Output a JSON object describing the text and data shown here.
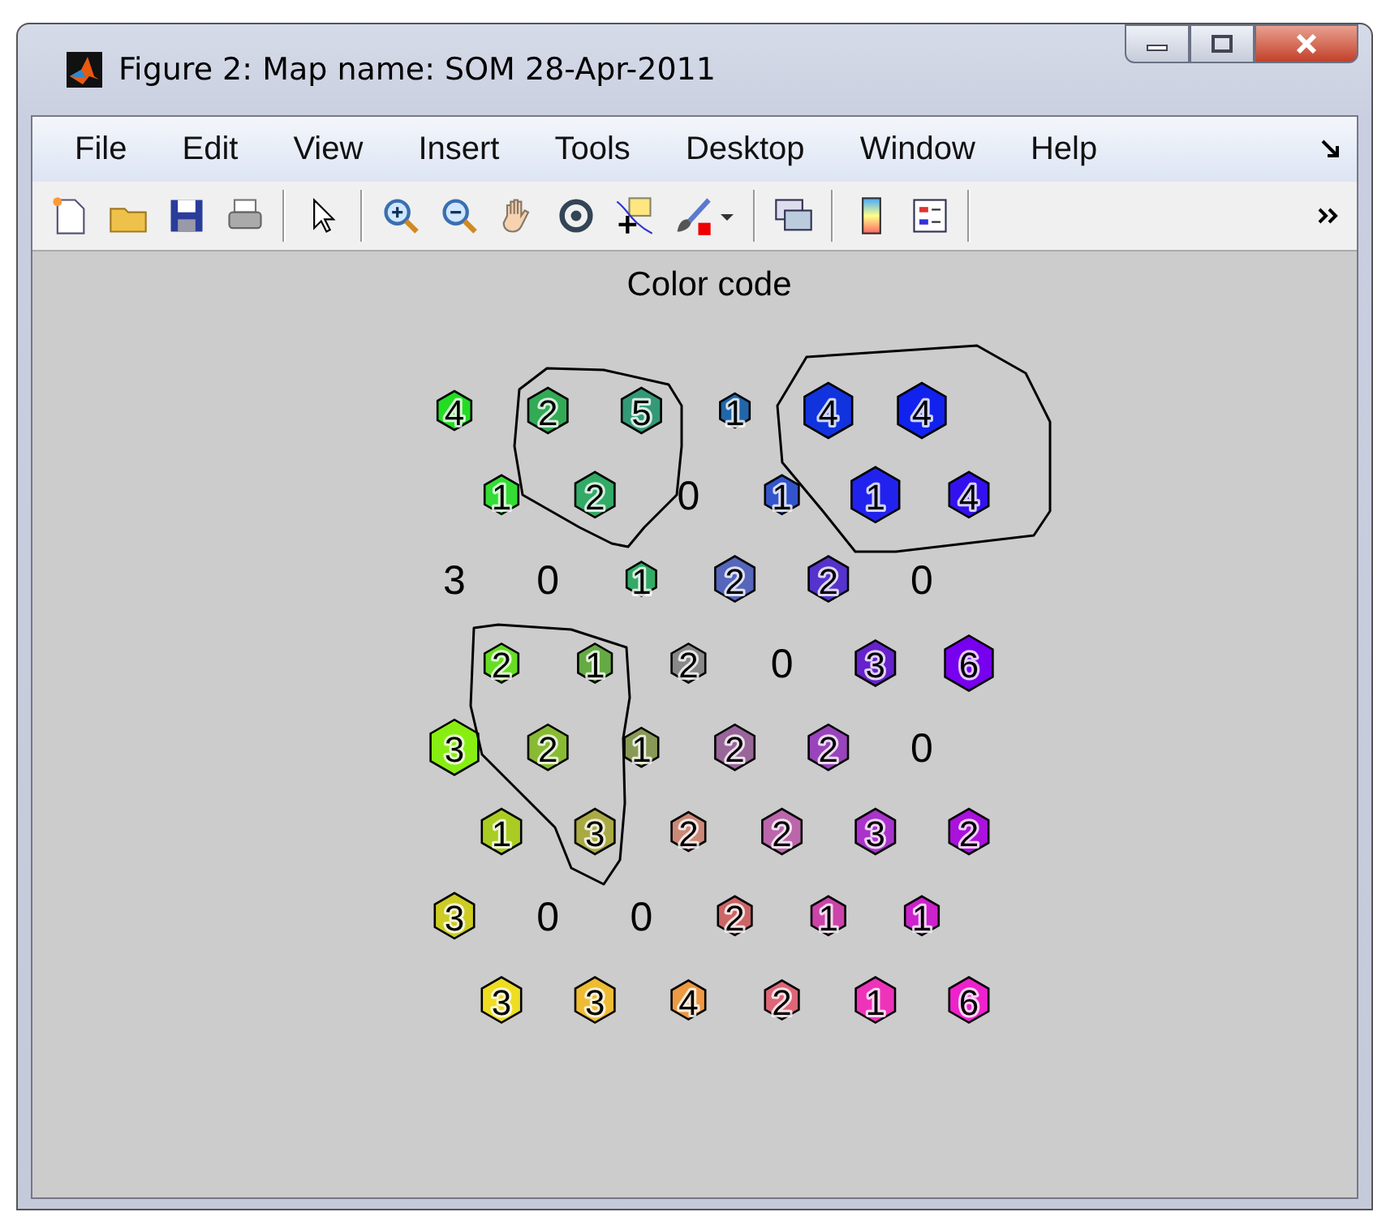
{
  "window": {
    "title": "Figure 2: Map name: SOM 28-Apr-2011"
  },
  "menu": [
    "File",
    "Edit",
    "View",
    "Insert",
    "Tools",
    "Desktop",
    "Window",
    "Help"
  ],
  "plot": {
    "title": "Color code",
    "cells": [
      [
        {
          "label": "4",
          "color": "#22dd22",
          "kind": "small"
        },
        {
          "label": "2",
          "color": "#33aa55",
          "kind": "medium"
        },
        {
          "label": "5",
          "color": "#339977",
          "kind": "medium"
        },
        {
          "label": "1",
          "color": "#2266aa",
          "kind": "tiny"
        },
        {
          "label": "4",
          "color": "#1133dd",
          "kind": "large"
        },
        {
          "label": "4",
          "color": "#1122ee",
          "kind": "large"
        }
      ],
      [
        {
          "label": "1",
          "color": "#33dd33",
          "kind": "small"
        },
        {
          "label": "2",
          "color": "#33aa66",
          "kind": "medium"
        },
        {
          "label": "0"
        },
        {
          "label": "1",
          "color": "#3355cc",
          "kind": "small"
        },
        {
          "label": "1",
          "color": "#2222ee",
          "kind": "large"
        },
        {
          "label": "4",
          "color": "#3311ee",
          "kind": "medium"
        }
      ],
      [
        {
          "label": "3"
        },
        {
          "label": "0"
        },
        {
          "label": "1",
          "color": "#33aa66",
          "kind": "tiny"
        },
        {
          "label": "2",
          "color": "#5566bb",
          "kind": "medium"
        },
        {
          "label": "2",
          "color": "#5533cc",
          "kind": "medium"
        },
        {
          "label": "0"
        }
      ],
      [
        {
          "label": "2",
          "color": "#66dd22",
          "kind": "small"
        },
        {
          "label": "1",
          "color": "#66aa44",
          "kind": "small"
        },
        {
          "label": "2",
          "color": "#888888",
          "kind": "small"
        },
        {
          "label": "0"
        },
        {
          "label": "3",
          "color": "#6622cc",
          "kind": "medium"
        },
        {
          "label": "6",
          "color": "#7700ee",
          "kind": "large"
        }
      ],
      [
        {
          "label": "3",
          "color": "#88ee11",
          "kind": "large"
        },
        {
          "label": "2",
          "color": "#88bb33",
          "kind": "medium"
        },
        {
          "label": "1",
          "color": "#889955",
          "kind": "small"
        },
        {
          "label": "2",
          "color": "#996699",
          "kind": "medium"
        },
        {
          "label": "2",
          "color": "#9944bb",
          "kind": "medium"
        },
        {
          "label": "0"
        }
      ],
      [
        {
          "label": "1",
          "color": "#aacc22",
          "kind": "medium"
        },
        {
          "label": "3",
          "color": "#aaaa44",
          "kind": "medium"
        },
        {
          "label": "2",
          "color": "#cc8877",
          "kind": "small"
        },
        {
          "label": "2",
          "color": "#bb66aa",
          "kind": "medium"
        },
        {
          "label": "3",
          "color": "#aa33cc",
          "kind": "medium"
        },
        {
          "label": "2",
          "color": "#aa11dd",
          "kind": "medium"
        }
      ],
      [
        {
          "label": "3",
          "color": "#cccc22",
          "kind": "medium"
        },
        {
          "label": "0"
        },
        {
          "label": "0"
        },
        {
          "label": "2",
          "color": "#cc6666",
          "kind": "small"
        },
        {
          "label": "1",
          "color": "#cc44aa",
          "kind": "small"
        },
        {
          "label": "1",
          "color": "#cc22cc",
          "kind": "small"
        }
      ],
      [
        {
          "label": "3",
          "color": "#eedd22",
          "kind": "medium"
        },
        {
          "label": "3",
          "color": "#eebb33",
          "kind": "medium"
        },
        {
          "label": "4",
          "color": "#ee9944",
          "kind": "small"
        },
        {
          "label": "2",
          "color": "#dd6677",
          "kind": "small"
        },
        {
          "label": "1",
          "color": "#ee33bb",
          "kind": "medium"
        },
        {
          "label": "6",
          "color": "#ee22cc",
          "kind": "medium"
        }
      ]
    ]
  }
}
